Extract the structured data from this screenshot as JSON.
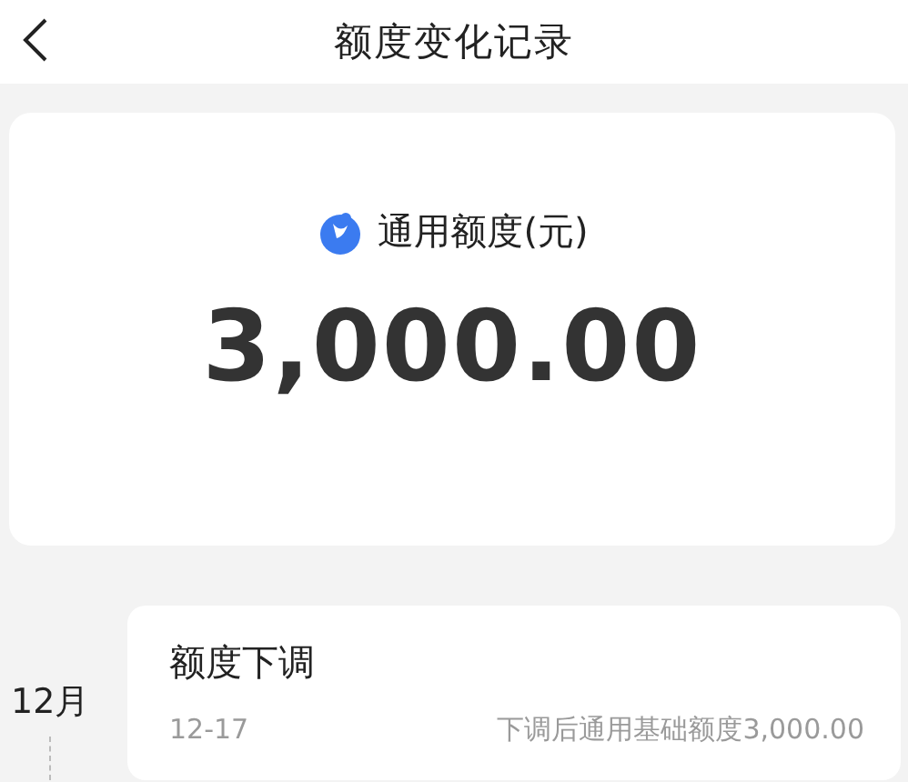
{
  "header": {
    "title": "额度变化记录"
  },
  "summary": {
    "label": "通用额度(元)",
    "amount": "3,000.00"
  },
  "records": [
    {
      "month": "12月",
      "title": "额度下调",
      "date": "12-17",
      "detail": "下调后通用基础额度3,000.00"
    }
  ]
}
